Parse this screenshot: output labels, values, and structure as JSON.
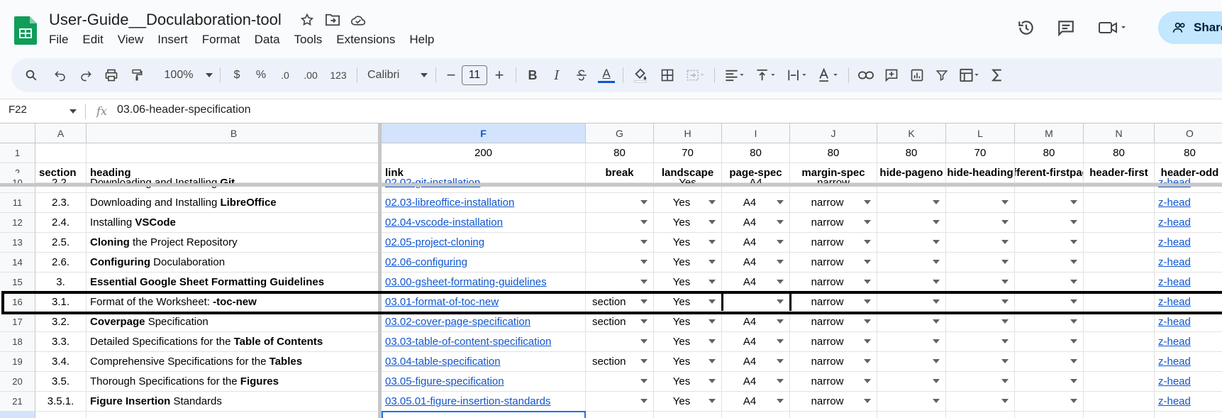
{
  "document": {
    "title": "User-Guide__Doculaboration-tool"
  },
  "menu": [
    "File",
    "Edit",
    "View",
    "Insert",
    "Format",
    "Data",
    "Tools",
    "Extensions",
    "Help"
  ],
  "header_right": {
    "share_label": "Share"
  },
  "toolbar": {
    "zoom": "100%",
    "currency": "$",
    "percent": "%",
    "decrease_decimal": ".0",
    "increase_decimal": ".00",
    "number_format": "123",
    "font": "Calibri",
    "font_size": "11",
    "minus": "−",
    "plus": "+",
    "bold": "B",
    "italic": "I",
    "text_color_glyph": "A"
  },
  "formula_bar": {
    "name_box": "F22",
    "fx": "fx",
    "value": "03.06-header-specification"
  },
  "grid": {
    "columns": [
      {
        "letter": "A"
      },
      {
        "letter": "B"
      },
      {
        "letter": "F"
      },
      {
        "letter": "G"
      },
      {
        "letter": "H"
      },
      {
        "letter": "I"
      },
      {
        "letter": "J"
      },
      {
        "letter": "K"
      },
      {
        "letter": "L"
      },
      {
        "letter": "M"
      },
      {
        "letter": "N"
      },
      {
        "letter": "O"
      }
    ],
    "row1": {
      "num": "1",
      "F": "200",
      "G": "80",
      "H": "70",
      "I": "80",
      "J": "80",
      "K": "80",
      "L": "70",
      "M": "80",
      "N": "80",
      "O": "80"
    },
    "row2": {
      "num": "2",
      "A": "section",
      "B": "heading",
      "F": "link",
      "G": "break",
      "H": "landscape",
      "I": "page-spec",
      "J": "margin-spec",
      "K": "hide-pageno",
      "L": "hide-heading",
      "M": "different-firstpage",
      "N": "header-first",
      "O": "header-odd"
    },
    "partial_row": {
      "num": "10",
      "A": "2.2.",
      "B_plain": "Downloading and Installing ",
      "B_bold": "Git",
      "F": "02.02-git-installation",
      "H": "Yes",
      "I": "A4",
      "J": "narrow",
      "O": "z-head"
    },
    "rows": [
      {
        "num": "11",
        "section": "2.3.",
        "pre": "Downloading and Installing ",
        "bold": "LibreOffice",
        "post": "",
        "link": "02.03-libreoffice-installation",
        "break": "",
        "landscape": "Yes",
        "page": "A4",
        "margin": "narrow",
        "header": "z-head"
      },
      {
        "num": "12",
        "section": "2.4.",
        "pre": "Installing ",
        "bold": "VSCode",
        "post": "",
        "link": "02.04-vscode-installation",
        "break": "",
        "landscape": "Yes",
        "page": "A4",
        "margin": "narrow",
        "header": "z-head"
      },
      {
        "num": "13",
        "section": "2.5.",
        "pre": "",
        "bold": "Cloning",
        "post": " the Project Repository",
        "link": "02.05-project-cloning",
        "break": "",
        "landscape": "Yes",
        "page": "A4",
        "margin": "narrow",
        "header": "z-head"
      },
      {
        "num": "14",
        "section": "2.6.",
        "pre": "",
        "bold": "Configuring",
        "post": " Doculaboration",
        "link": "02.06-configuring",
        "break": "",
        "landscape": "Yes",
        "page": "A4",
        "margin": "narrow",
        "header": "z-head"
      },
      {
        "num": "15",
        "section": "3.",
        "pre": "",
        "bold": "Essential Google Sheet Formatting Guidelines",
        "post": "",
        "link": "03.00-gsheet-formating-guidelines",
        "break": "",
        "landscape": "Yes",
        "page": "A4",
        "margin": "narrow",
        "header": "z-head"
      },
      {
        "num": "16",
        "section": "3.1.",
        "pre": "Format of the Worksheet: ",
        "bold": "-toc-new",
        "post": "",
        "link": "03.01-format-of-toc-new",
        "break": "section",
        "landscape": "Yes",
        "page": "",
        "margin": "narrow",
        "header": "z-head"
      },
      {
        "num": "17",
        "section": "3.2.",
        "pre": "",
        "bold": "Coverpage",
        "post": " Specification",
        "link": "03.02-cover-page-specification",
        "break": "section",
        "landscape": "Yes",
        "page": "A4",
        "margin": "narrow",
        "header": "z-head"
      },
      {
        "num": "18",
        "section": "3.3.",
        "pre": "Detailed Specifications for the ",
        "bold": "Table of Contents",
        "post": "",
        "link": "03.03-table-of-content-specification",
        "break": "",
        "landscape": "Yes",
        "page": "A4",
        "margin": "narrow",
        "header": "z-head"
      },
      {
        "num": "19",
        "section": "3.4.",
        "pre": "Comprehensive Specifications for the ",
        "bold": "Tables",
        "post": "",
        "link": "03.04-table-specification",
        "break": "section",
        "landscape": "Yes",
        "page": "A4",
        "margin": "narrow",
        "header": "z-head"
      },
      {
        "num": "20",
        "section": "3.5.",
        "pre": "Thorough Specifications for the ",
        "bold": "Figures",
        "post": "",
        "link": "03.05-figure-specification",
        "break": "",
        "landscape": "Yes",
        "page": "A4",
        "margin": "narrow",
        "header": "z-head"
      },
      {
        "num": "21",
        "section": "3.5.1.",
        "pre": "",
        "bold": "Figure Insertion",
        "post": " Standards",
        "link": "03.05.01-figure-insertion-standards",
        "break": "",
        "landscape": "Yes",
        "page": "A4",
        "margin": "narrow",
        "header": "z-head"
      }
    ]
  },
  "colors": {
    "accent": "#0b57d0",
    "link": "#1155cc",
    "share_bg": "#c2e7ff",
    "sheets_green": "#0f9d58"
  }
}
